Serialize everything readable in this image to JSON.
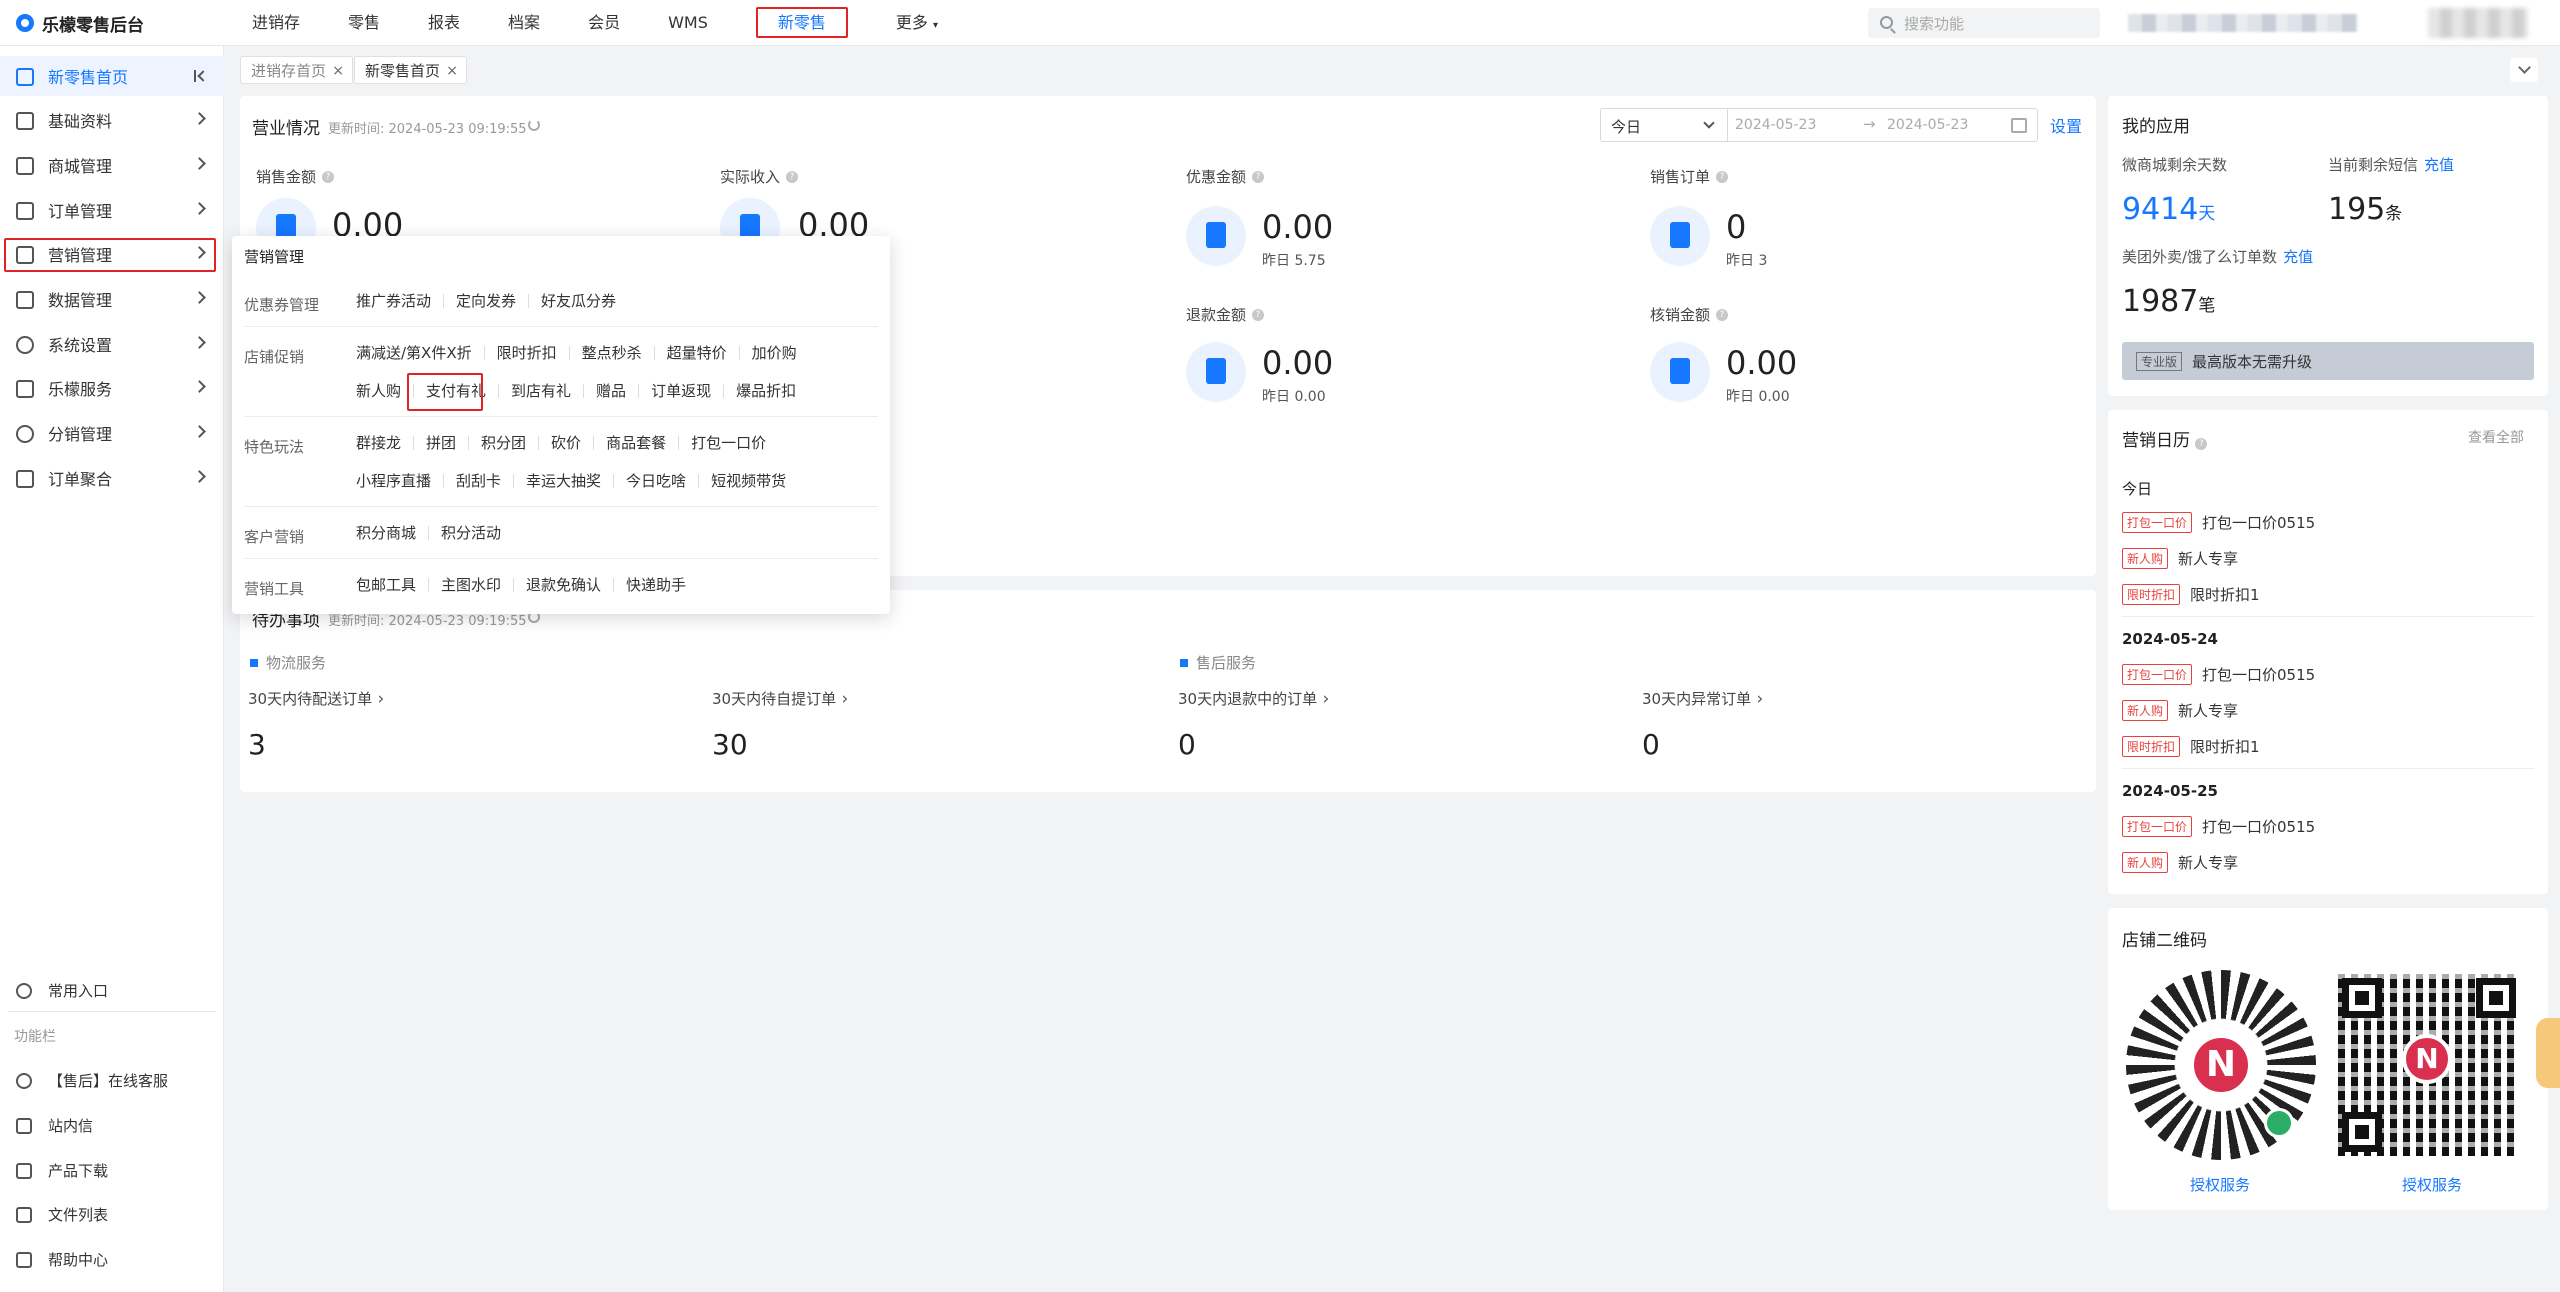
{
  "app": {
    "title": "乐檬零售后台"
  },
  "topnav": {
    "items": [
      "进销存",
      "零售",
      "报表",
      "档案",
      "会员",
      "WMS",
      "新零售",
      "更多"
    ],
    "active": "新零售"
  },
  "search": {
    "placeholder": "搜索功能"
  },
  "sidebar": {
    "items": [
      {
        "label": "新零售首页"
      },
      {
        "label": "基础资料"
      },
      {
        "label": "商城管理"
      },
      {
        "label": "订单管理"
      },
      {
        "label": "营销管理"
      },
      {
        "label": "数据管理"
      },
      {
        "label": "系统设置"
      },
      {
        "label": "乐檬服务"
      },
      {
        "label": "分销管理"
      },
      {
        "label": "订单聚合"
      }
    ],
    "common": "常用入口",
    "section": "功能栏",
    "bottom": [
      "【售后】在线客服",
      "站内信",
      "产品下载",
      "文件列表",
      "帮助中心"
    ]
  },
  "tabs": [
    {
      "label": "进销存首页"
    },
    {
      "label": "新零售首页"
    }
  ],
  "business": {
    "title": "营业情况",
    "update": "更新时间: 2024-05-23 09:19:55",
    "date_select": "今日",
    "date_from": "2024-05-23",
    "date_arrow": "→",
    "date_to": "2024-05-23",
    "setting": "设置",
    "metrics": [
      {
        "label": "销售金额",
        "value": "0.00",
        "sub": ""
      },
      {
        "label": "实际收入",
        "value": "0.00",
        "sub": ""
      },
      {
        "label": "优惠金额",
        "value": "0.00",
        "sub": "昨日 5.75"
      },
      {
        "label": "销售订单",
        "value": "0",
        "sub": "昨日 3"
      },
      {
        "label": "退款金额",
        "value": "0.00",
        "sub": "昨日 0.00"
      },
      {
        "label": "核销金额",
        "value": "0.00",
        "sub": "昨日 0.00"
      }
    ]
  },
  "todo": {
    "title": "待办事项",
    "update": "更新时间: 2024-05-23 09:19:55",
    "sections": [
      "物流服务",
      "售后服务"
    ],
    "items": [
      {
        "label": "30天内待配送订单",
        "value": "3"
      },
      {
        "label": "30天内待自提订单",
        "value": "30"
      },
      {
        "label": "30天内退款中的订单",
        "value": "0"
      },
      {
        "label": "30天内异常订单",
        "value": "0"
      }
    ]
  },
  "my_apps": {
    "title": "我的应用",
    "mall_days_label": "微商城剩余天数",
    "mall_days": "9414",
    "mall_days_unit": "天",
    "sms_label": "当前剩余短信",
    "sms_recharge": "充值",
    "sms": "195",
    "sms_unit": "条",
    "meituan_label": "美团外卖/饿了么订单数",
    "meituan_recharge": "充值",
    "meituan": "1987",
    "meituan_unit": "笔",
    "edition_badge": "专业版",
    "edition_text": "最高版本无需升级"
  },
  "calendar": {
    "title": "营销日历",
    "see_all": "查看全部",
    "days": [
      {
        "day": "今日",
        "events": [
          {
            "tag": "打包一口价",
            "name": "打包一口价0515"
          },
          {
            "tag": "新人购",
            "name": "新人专享"
          },
          {
            "tag": "限时折扣",
            "name": "限时折扣1"
          }
        ]
      },
      {
        "day": "2024-05-24",
        "events": [
          {
            "tag": "打包一口价",
            "name": "打包一口价0515"
          },
          {
            "tag": "新人购",
            "name": "新人专享"
          },
          {
            "tag": "限时折扣",
            "name": "限时折扣1"
          }
        ]
      },
      {
        "day": "2024-05-25",
        "events": [
          {
            "tag": "打包一口价",
            "name": "打包一口价0515"
          },
          {
            "tag": "新人购",
            "name": "新人专享"
          }
        ]
      }
    ]
  },
  "qrcode": {
    "title": "店铺二维码",
    "links": [
      "授权服务",
      "授权服务"
    ],
    "logo_letter": "N"
  },
  "popup": {
    "title": "营销管理",
    "categories": [
      {
        "name": "优惠券管理",
        "rows": [
          [
            "推广券活动",
            "定向发券",
            "好友瓜分券"
          ]
        ]
      },
      {
        "name": "店铺促销",
        "rows": [
          [
            "满减送/第X件X折",
            "限时折扣",
            "整点秒杀",
            "超量特价",
            "加价购"
          ],
          [
            "新人购",
            "支付有礼",
            "到店有礼",
            "赠品",
            "订单返现",
            "爆品折扣"
          ]
        ]
      },
      {
        "name": "特色玩法",
        "rows": [
          [
            "群接龙",
            "拼团",
            "积分团",
            "砍价",
            "商品套餐",
            "打包一口价"
          ],
          [
            "小程序直播",
            "刮刮卡",
            "幸运大抽奖",
            "今日吃啥",
            "短视频带货"
          ]
        ]
      },
      {
        "name": "客户营销",
        "rows": [
          [
            "积分商城",
            "积分活动"
          ]
        ]
      },
      {
        "name": "营销工具",
        "rows": [
          [
            "包邮工具",
            "主图水印",
            "退款免确认",
            "快递助手"
          ]
        ]
      }
    ]
  }
}
